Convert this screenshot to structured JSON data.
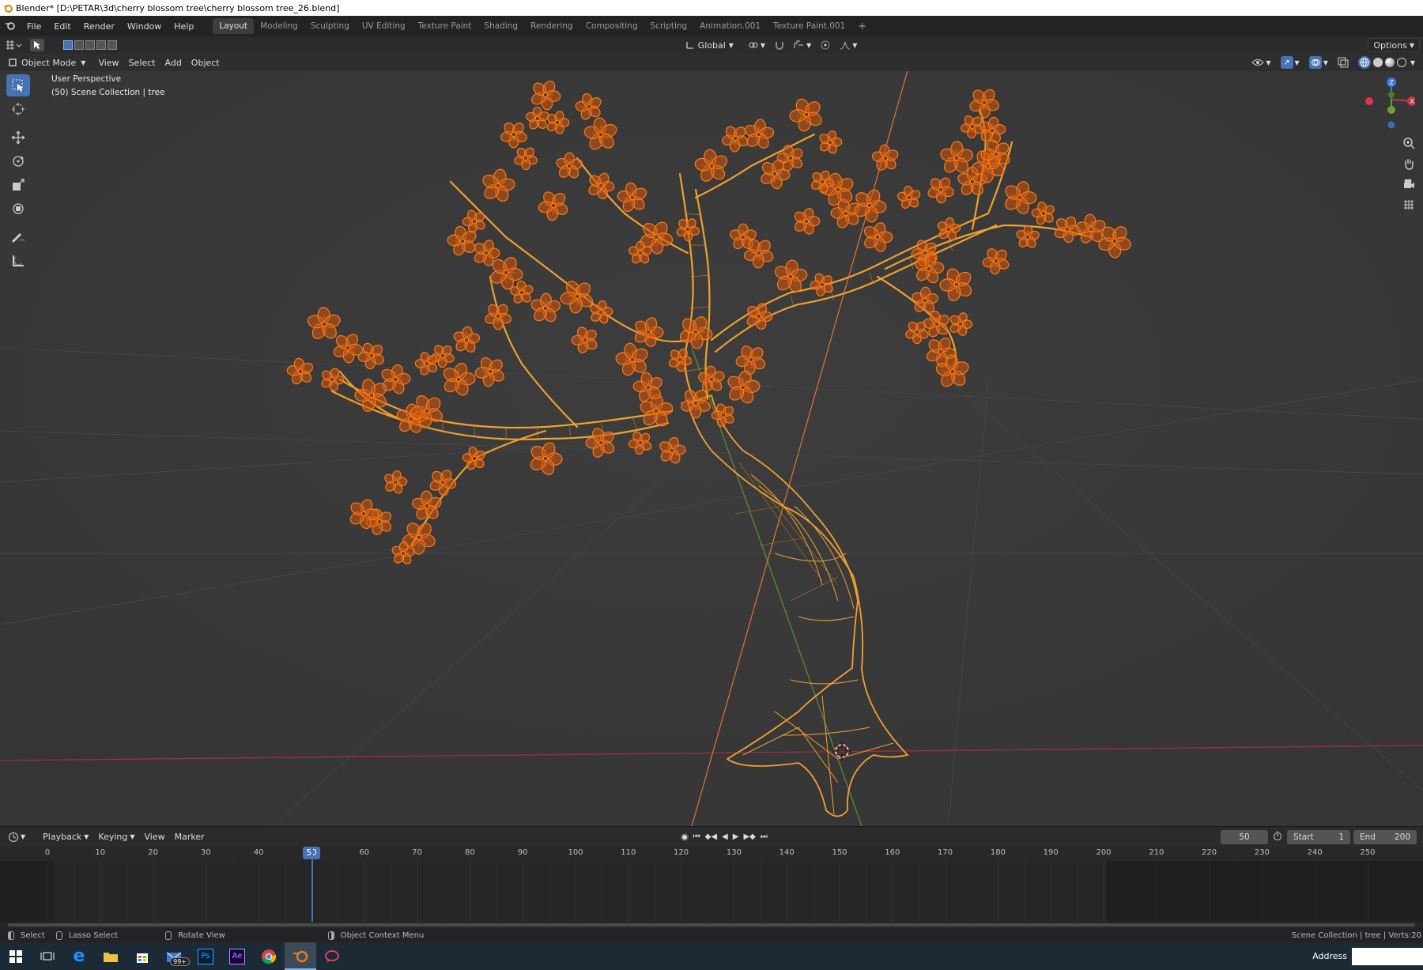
{
  "window": {
    "title": "Blender* [D:\\PETAR\\3d\\cherry blossom tree\\cherry blossom tree_26.blend]"
  },
  "menu": {
    "items": [
      "File",
      "Edit",
      "Render",
      "Window",
      "Help"
    ]
  },
  "workspaces": [
    "Layout",
    "Modeling",
    "Sculpting",
    "UV Editing",
    "Texture Paint",
    "Shading",
    "Rendering",
    "Compositing",
    "Scripting",
    "Animation.001",
    "Texture Paint.001"
  ],
  "active_workspace": "Layout",
  "header": {
    "transform_orientation": "Global",
    "options_label": "Options"
  },
  "viewport_header": {
    "mode": "Object Mode",
    "menus": [
      "View",
      "Select",
      "Add",
      "Object"
    ]
  },
  "viewport": {
    "perspective_label": "User Perspective",
    "collection_label": "(50) Scene Collection | tree"
  },
  "gizmo": {
    "z": "Z",
    "y": "Y",
    "x": "X"
  },
  "timeline": {
    "menus": [
      "Playback",
      "Keying",
      "View",
      "Marker"
    ],
    "current_frame": "50",
    "start_label": "Start",
    "start": "1",
    "end_label": "End",
    "end": "200",
    "ticks": [
      "0",
      "10",
      "20",
      "30",
      "40",
      "50",
      "60",
      "70",
      "80",
      "90",
      "100",
      "110",
      "120",
      "130",
      "140",
      "150",
      "160",
      "170",
      "180",
      "190",
      "200",
      "210",
      "220",
      "230",
      "240",
      "250"
    ]
  },
  "statusbar": {
    "select": "Select",
    "lasso": "Lasso Select",
    "rotate": "Rotate View",
    "context": "Object Context Menu",
    "right": "Scene Collection | tree | Verts:20"
  },
  "taskbar": {
    "badge": "99+",
    "address_label": "Address"
  },
  "colors": {
    "accent": "#4772b3",
    "selection": "#ff7a14",
    "wire": "#f0a030",
    "x_axis": "#b83a4a",
    "y_axis": "#6e9a3a"
  }
}
